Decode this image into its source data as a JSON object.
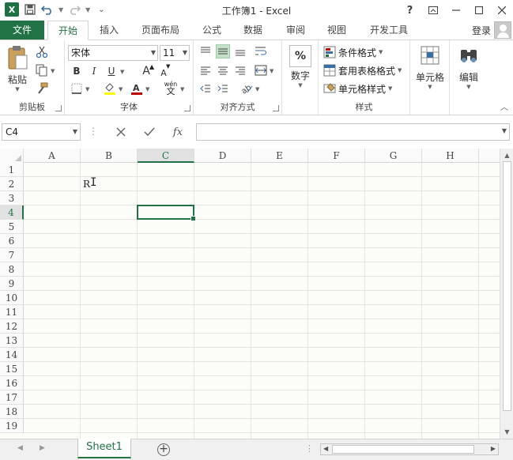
{
  "window": {
    "title": "工作簿1 - Excel",
    "help": "?",
    "app_icon": "X"
  },
  "tabs": [
    {
      "label": "文件"
    },
    {
      "label": "开始"
    },
    {
      "label": "插入"
    },
    {
      "label": "页面布局"
    },
    {
      "label": "公式"
    },
    {
      "label": "数据"
    },
    {
      "label": "审阅"
    },
    {
      "label": "视图"
    },
    {
      "label": "开发工具"
    }
  ],
  "active_tab": "开始",
  "login_label": "登录",
  "ribbon": {
    "clipboard": {
      "label": "剪贴板",
      "paste_label": "粘贴"
    },
    "font": {
      "label": "字体",
      "font_name": "宋体",
      "font_size": "11",
      "bold": "B",
      "italic": "I",
      "underline": "U",
      "grow": "A",
      "shrink": "A",
      "pinyin": "wén",
      "pinyin_char": "文"
    },
    "alignment": {
      "label": "对齐方式"
    },
    "number": {
      "label": "数字",
      "btn_label": "数字",
      "icon_text": "%"
    },
    "styles": {
      "label": "样式",
      "conditional": "条件格式",
      "table_format": "套用表格格式",
      "cell_styles": "单元格样式"
    },
    "cells": {
      "btn_label": "单元格"
    },
    "editing": {
      "btn_label": "编辑"
    }
  },
  "formula_bar": {
    "name_box": "C4",
    "fx": "fx",
    "formula": ""
  },
  "grid": {
    "columns": [
      "A",
      "B",
      "C",
      "D",
      "E",
      "F",
      "G",
      "H"
    ],
    "rows": [
      "1",
      "2",
      "3",
      "4",
      "5",
      "6",
      "7",
      "8",
      "9",
      "10",
      "11",
      "12",
      "13",
      "14",
      "15",
      "16",
      "17",
      "18",
      "19"
    ],
    "selected_column": "C",
    "selected_row": "4",
    "cells": [
      {
        "ref": "B2",
        "value": "R"
      }
    ]
  },
  "sheets": [
    {
      "name": "Sheet1",
      "active": true
    }
  ],
  "colors": {
    "accent": "#217346",
    "file_tab": "#217346"
  }
}
